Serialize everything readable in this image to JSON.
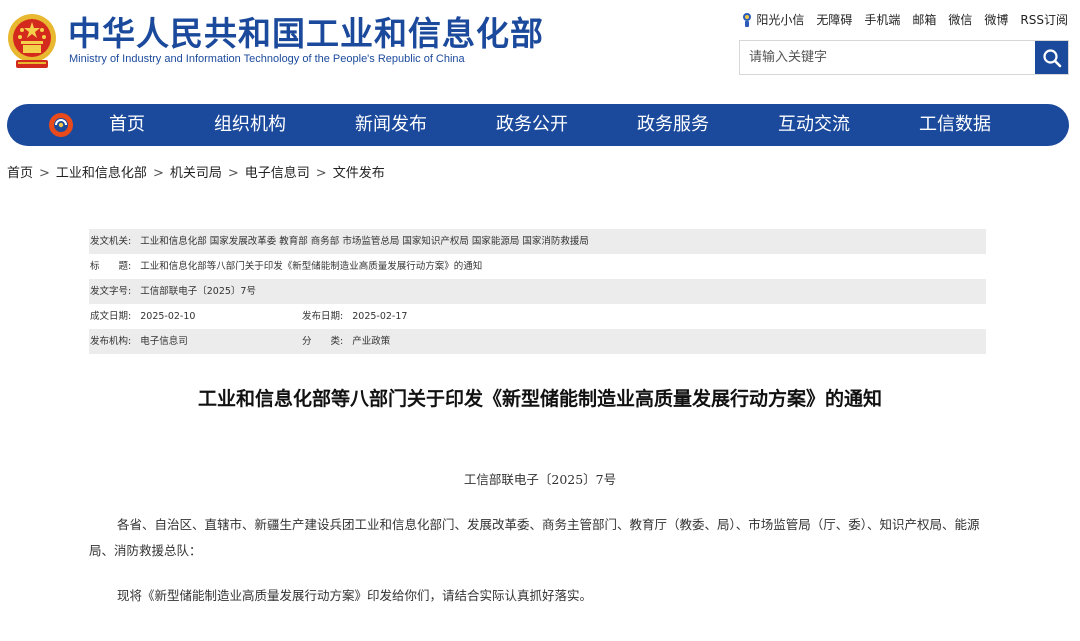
{
  "header": {
    "title": "中华人民共和国工业和信息化部",
    "subtitle": "Ministry of Industry and Information Technology of the People's Republic of China"
  },
  "toplinks": [
    {
      "label": "阳光小信",
      "icon": "sun-mascot-icon"
    },
    {
      "label": "无障碍"
    },
    {
      "label": "手机端"
    },
    {
      "label": "邮箱"
    },
    {
      "label": "微信"
    },
    {
      "label": "微博"
    },
    {
      "label": "RSS订阅"
    }
  ],
  "search": {
    "placeholder": "请输入关键字",
    "icon": "search-icon"
  },
  "nav": {
    "items": [
      "首页",
      "组织机构",
      "新闻发布",
      "政务公开",
      "政务服务",
      "互动交流",
      "工信数据"
    ]
  },
  "breadcrumb": [
    "首页",
    "工业和信息化部",
    "机关司局",
    "电子信息司",
    "文件发布"
  ],
  "meta": {
    "issuer_label": "发文机关:",
    "issuer": "工业和信息化部 国家发展改革委 教育部 商务部 市场监管总局 国家知识产权局 国家能源局 国家消防救援局",
    "title_label": "标　　题:",
    "title": "工业和信息化部等八部门关于印发《新型储能制造业高质量发展行动方案》的通知",
    "docno_label": "发文字号:",
    "docno": "工信部联电子〔2025〕7号",
    "created_label": "成文日期:",
    "created": "2025-02-10",
    "published_label": "发布日期:",
    "published": "2025-02-17",
    "org_label": "发布机构:",
    "org": "电子信息司",
    "category_label": "分　　类:",
    "category": "产业政策"
  },
  "article": {
    "title": "工业和信息化部等八部门关于印发《新型储能制造业高质量发展行动方案》的通知",
    "doc_number": "工信部联电子〔2025〕7号",
    "paragraphs": [
      "各省、自治区、直辖市、新疆生产建设兵团工业和信息化部门、发展改革委、商务主管部门、教育厅（教委、局）、市场监管局（厅、委）、知识产权局、能源局、消防救援总队：",
      "现将《新型储能制造业高质量发展行动方案》印发给你们，请结合实际认真抓好落实。"
    ]
  },
  "colors": {
    "brand_blue": "#1b4a9c",
    "meta_shade": "#ececec"
  }
}
